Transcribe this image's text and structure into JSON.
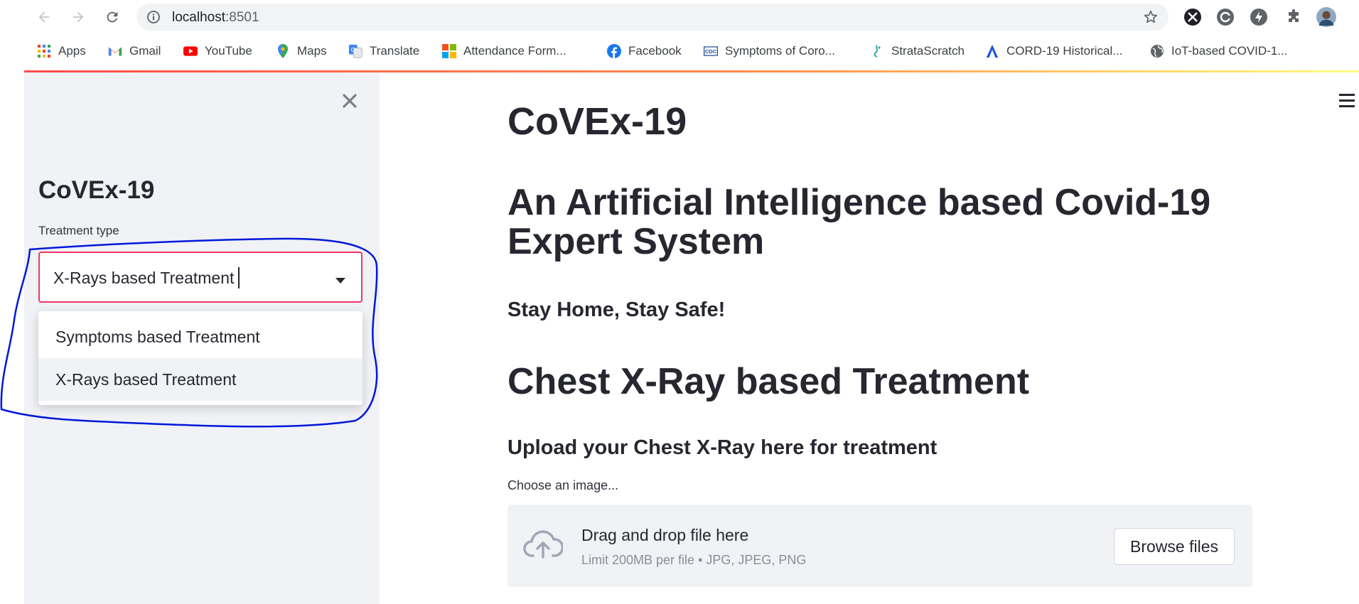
{
  "browser": {
    "url_host": "localhost",
    "url_port": ":8501",
    "bookmarks": [
      {
        "label": "Apps",
        "icon": "apps-grid-icon"
      },
      {
        "label": "Gmail",
        "icon": "gmail-icon"
      },
      {
        "label": "YouTube",
        "icon": "youtube-icon"
      },
      {
        "label": "Maps",
        "icon": "maps-icon"
      },
      {
        "label": "Translate",
        "icon": "translate-icon"
      },
      {
        "label": "Attendance Form...",
        "icon": "microsoft-icon"
      },
      {
        "label": "Facebook",
        "icon": "facebook-icon"
      },
      {
        "label": "Symptoms of Coro...",
        "icon": "cdc-icon"
      },
      {
        "label": "StrataScratch",
        "icon": "stratascratch-icon"
      },
      {
        "label": "CORD-19 Historical...",
        "icon": "cord19-icon"
      },
      {
        "label": "IoT-based COVID-1...",
        "icon": "globe-icon"
      }
    ],
    "cdc_icon_text": "CDC"
  },
  "sidebar": {
    "title": "CoVEx-19",
    "select_label": "Treatment type",
    "select_value": "X-Rays based Treatment",
    "options": [
      "Symptoms based Treatment",
      "X-Rays based Treatment"
    ],
    "selected_option_index": 1
  },
  "main": {
    "title": "CoVEx-19",
    "subtitle": "An Artificial Intelligence based Covid-19 Expert System",
    "tagline": "Stay Home, Stay Safe!",
    "section_header": "Chest X-Ray based Treatment",
    "upload_header": "Upload your Chest X-Ray here for treatment",
    "uploader_label": "Choose an image...",
    "dropzone_text": "Drag and drop file here",
    "dropzone_limit": "Limit 200MB per file • JPG, JPEG, PNG",
    "browse_button": "Browse files"
  },
  "colors": {
    "accent": "#f63366",
    "sidebar_bg": "#f0f2f6",
    "text": "#262730",
    "annotation": "#0018d8"
  }
}
